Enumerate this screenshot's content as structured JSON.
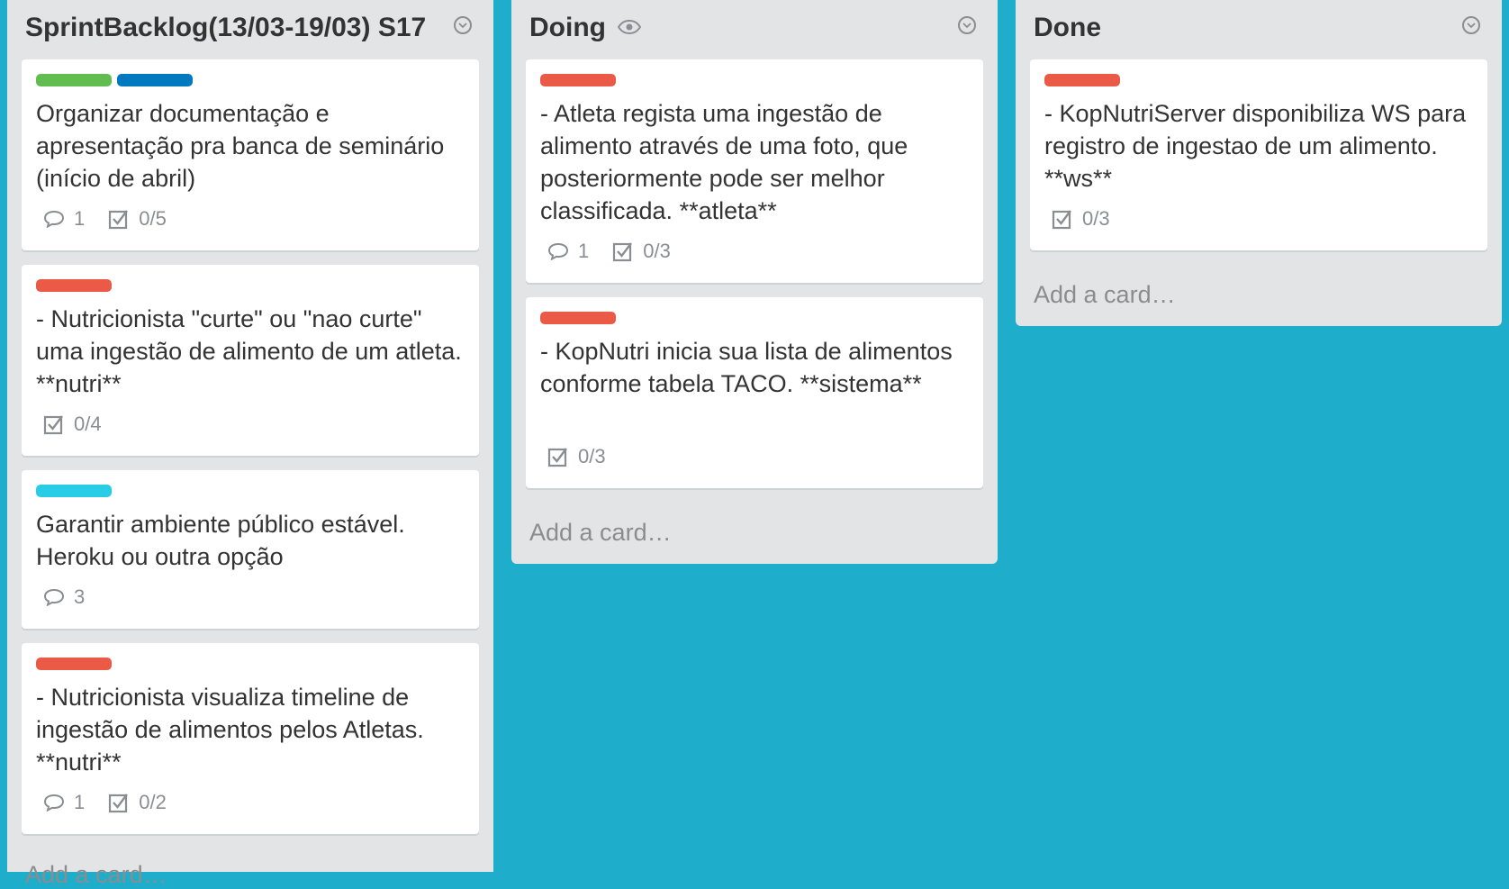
{
  "colors": {
    "board_bg": "#1fadcc",
    "list_bg": "#e2e4e6",
    "label_green": "#61bd4f",
    "label_blue": "#0079bf",
    "label_red": "#eb5a46",
    "label_sky": "#29cce5"
  },
  "lists": [
    {
      "title": "SprintBacklog(13/03-19/03) S17",
      "add_card": "Add a card…",
      "cards": [
        {
          "labels": [
            "green",
            "blue"
          ],
          "text": "Organizar documentação e apresentação pra banca de seminário (início de abril)",
          "comments": "1",
          "checklist": "0/5"
        },
        {
          "labels": [
            "red"
          ],
          "text": "- Nutricionista \"curte\" ou \"nao curte\" uma ingestão de alimento de um atleta. **nutri**",
          "checklist": "0/4"
        },
        {
          "labels": [
            "sky"
          ],
          "text": "Garantir ambiente público estável. Heroku ou outra opção",
          "comments": "3"
        },
        {
          "labels": [
            "red"
          ],
          "text": "- Nutricionista visualiza timeline de ingestão de alimentos pelos Atletas. **nutri**",
          "comments": "1",
          "checklist": "0/2"
        }
      ]
    },
    {
      "title": "Doing",
      "watch_icon": "eye-icon",
      "add_card": "Add a card…",
      "cards": [
        {
          "labels": [
            "red"
          ],
          "text": "- Atleta regista uma ingestão de alimento através de uma foto, que posteriormente pode ser melhor classificada. **atleta**",
          "comments": "1",
          "checklist": "0/3"
        },
        {
          "labels": [
            "red"
          ],
          "text": "- KopNutri inicia sua lista de alimentos conforme tabela TACO. **sistema**",
          "checklist": "0/3"
        }
      ]
    },
    {
      "title": "Done",
      "add_card": "Add a card…",
      "cards": [
        {
          "labels": [
            "red"
          ],
          "text": "- KopNutriServer disponibiliza WS para registro de ingestao de um alimento. **ws**",
          "checklist": "0/3"
        }
      ]
    }
  ]
}
